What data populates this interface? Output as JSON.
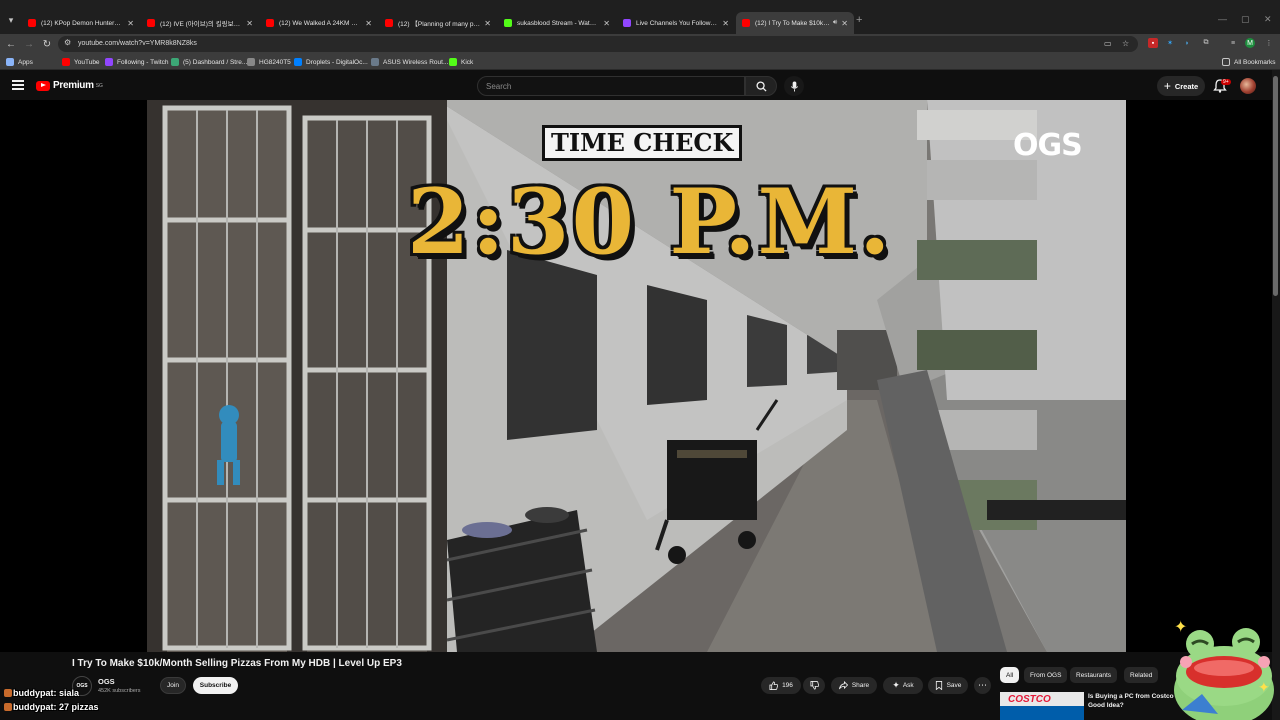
{
  "browser": {
    "tabs": [
      {
        "title": "(12) KPop Demon Hunters | Ho",
        "color": "#ff0000",
        "active": false
      },
      {
        "title": "(12) IVE (아이브)의 킬링보이스를",
        "color": "#ff0000",
        "active": false
      },
      {
        "title": "(12) We Walked A 24KM TRAIL",
        "color": "#ff0000",
        "active": false
      },
      {
        "title": "(12) 【Planning of many people",
        "color": "#ff0000",
        "active": false
      },
      {
        "title": "sukasblood Stream - Watch Liv",
        "color": "#53fc18",
        "active": false
      },
      {
        "title": "Live Channels You Follow - Twi",
        "color": "#9146ff",
        "active": false
      },
      {
        "title": "(12) I Try To Make $10k/Mo",
        "color": "#ff0000",
        "active": true
      }
    ],
    "url": "youtube.com/watch?v=YMR8k8NZ8ks",
    "bookmarks": [
      {
        "label": "Apps",
        "color": "#8ab4f8"
      },
      {
        "label": "YouTube",
        "color": "#ff0000"
      },
      {
        "label": "Following - Twitch",
        "color": "#9146ff"
      },
      {
        "label": "(5) Dashboard / Stre...",
        "color": "#3ca776"
      },
      {
        "label": "HG8240T5",
        "color": "#888888"
      },
      {
        "label": "Droplets - DigitalOc...",
        "color": "#0080ff"
      },
      {
        "label": "ASUS Wireless Rout...",
        "color": "#6a7a8a"
      },
      {
        "label": "Kick",
        "color": "#53fc18"
      }
    ],
    "all_bookmarks": "All Bookmarks"
  },
  "youtube": {
    "logo_text": "Premium",
    "logo_sup": "SG",
    "search_placeholder": "Search",
    "create_label": "Create",
    "notif_count": "9+"
  },
  "video": {
    "overlay_label": "TIME CHECK",
    "overlay_time": "2:30 P.M.",
    "watermark": "OGS",
    "title": "I Try To Make $10k/Month Selling Pizzas From My HDB | Level Up EP3",
    "channel_name": "OGS",
    "channel_avatar": "OGS",
    "subscribers": "452K subscribers",
    "join_label": "Join",
    "subscribe_label": "Subscribe",
    "likes": "196",
    "share_label": "Share",
    "ask_label": "Ask",
    "save_label": "Save"
  },
  "sidebar": {
    "chips": [
      "All",
      "From OGS",
      "Restaurants",
      "Related"
    ],
    "first_reco_title": "Is Buying a PC from Costco a Good Idea?",
    "first_reco_thumb_text": "COSTCO"
  },
  "chat": [
    {
      "user": "buddypat:",
      "message": "siala"
    },
    {
      "user": "buddypat:",
      "message": "27 pizzas"
    }
  ]
}
